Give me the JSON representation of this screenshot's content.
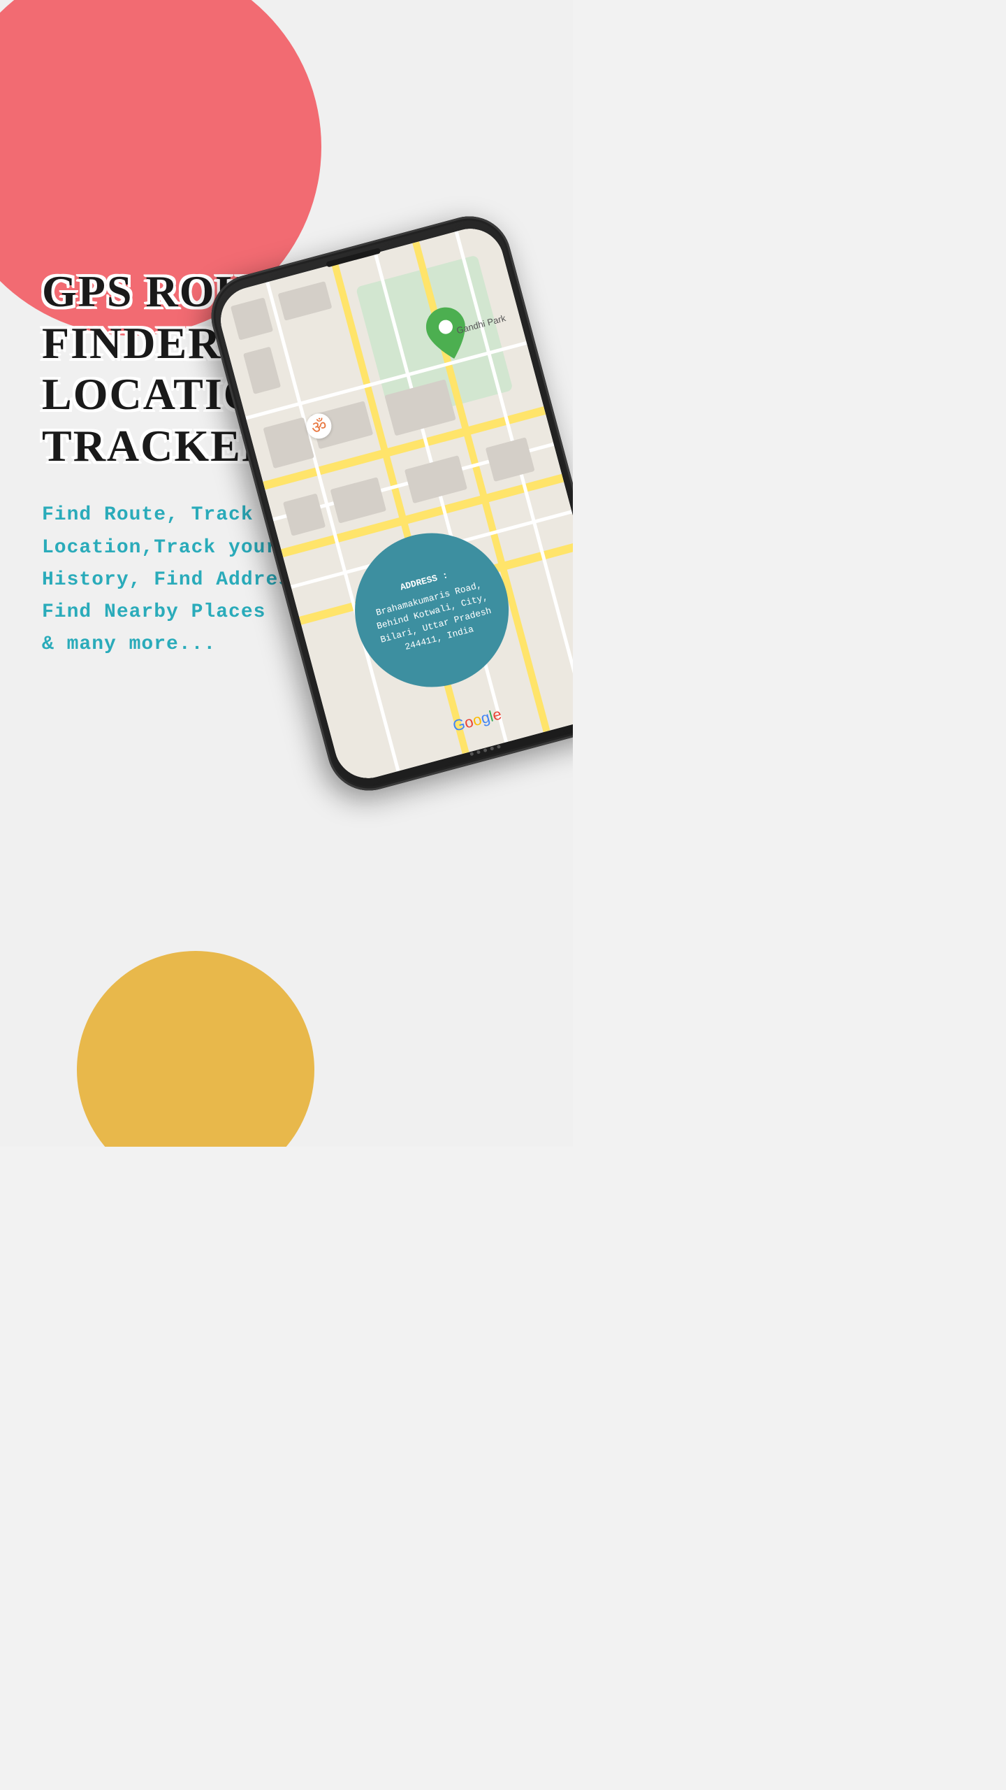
{
  "page": {
    "background_color": "#f0f0f0"
  },
  "decorations": {
    "circle_top_color": "#f26b72",
    "circle_bottom_color": "#e8b84b"
  },
  "app": {
    "title_line1": "GPS Route Finder &",
    "title_line2": "Location Tracker",
    "description_line1": "Find Route, Track your Current",
    "description_line2": "Location,Track your Location",
    "description_line3": "History, Find Address,",
    "description_line4": "Find Nearby Places",
    "description_line5": "& many more...",
    "text_color": "#2aabba"
  },
  "phone": {
    "map": {
      "landmark": "Gandhi Park",
      "om_symbol": "ॐ",
      "address_label": "ADDRESS :",
      "address_text": "Brahamakumaris Road, Behind Kotwali, City, Bilari, Uttar Pradesh 244411, India",
      "bubble_color": "#3d8fa0"
    },
    "google_logo": "Google"
  }
}
